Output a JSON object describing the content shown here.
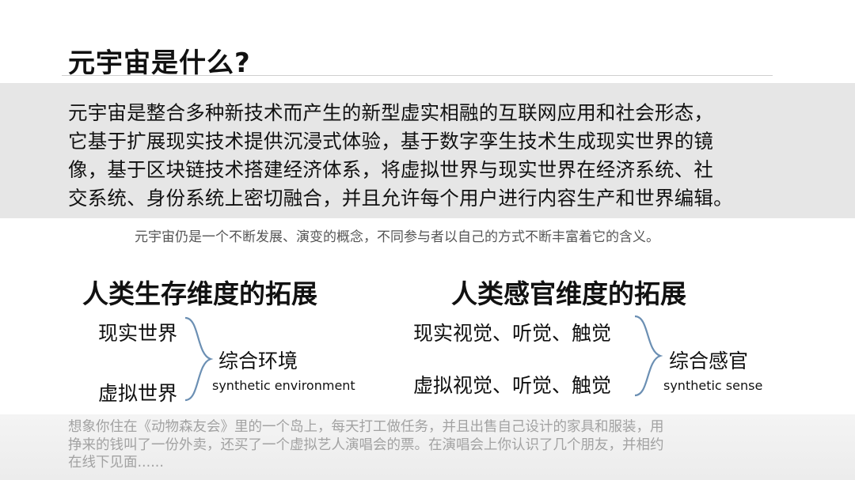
{
  "slide": {
    "title": "元宇宙是什么?",
    "definition": "元宇宙是整合多种新技术而产生的新型虚实相融的互联网应用和社会形态，\n它基于扩展现实技术提供沉浸式体验，基于数字孪生技术生成现实世界的镜\n像，基于区块链技术搭建经济体系，将虚拟世界与现实世界在经济系统、社\n交系统、身份系统上密切融合，并且允许每个用户进行内容生产和世界编辑。",
    "note": "元宇宙仍是一个不断发展、演变的概念，不同参与者以自己的方式不断丰富着它的含义。",
    "left_section": {
      "title": "人类生存维度的拓展",
      "items": [
        "现实世界",
        "虚拟世界"
      ],
      "result": "综合环境",
      "result_en": "synthetic environment"
    },
    "right_section": {
      "title": "人类感官维度的拓展",
      "items": [
        "现实视觉、听觉、触觉",
        "虚拟视觉、听觉、触觉"
      ],
      "result": "综合感官",
      "result_en": "synthetic sense"
    },
    "story": "想象你住在《动物森友会》里的一个岛上，每天打工做任务，并且出售自己设计的家具和服装，用\n挣来的钱叫了一份外卖，还买了一个虚拟艺人演唱会的票。在演唱会上你认识了几个朋友，并相约\n在线下见面......"
  },
  "colors": {
    "band": "#e6e6e6",
    "brace": "#6b8fb3",
    "note": "#555555",
    "story": "#a2a2a2"
  }
}
